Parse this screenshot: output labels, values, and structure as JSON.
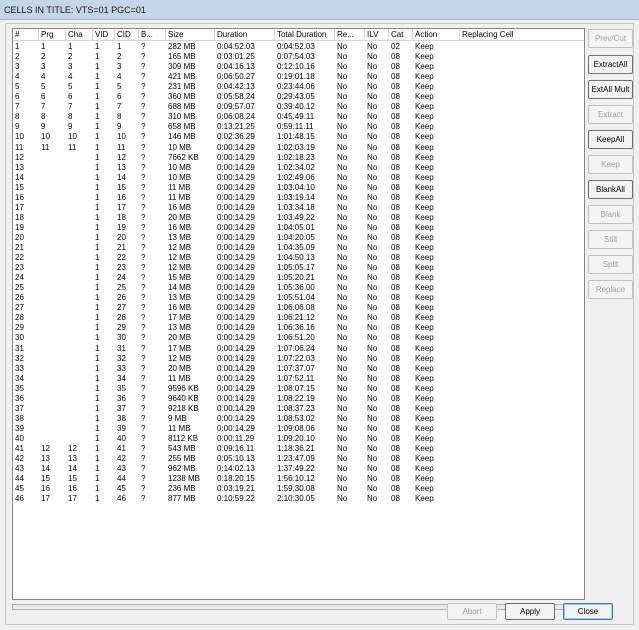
{
  "window": {
    "title": "CELLS IN TITLE: VTS=01 PGC=01"
  },
  "columns": [
    "#",
    "Prg",
    "Cha",
    "VID",
    "CID",
    "B...",
    "Size",
    "Duration",
    "Total Duration",
    "Re...",
    "ILV",
    "Cat",
    "Action",
    "Replacing Cell"
  ],
  "rows": [
    [
      "1",
      "1",
      "1",
      "1",
      "1",
      "?",
      "282 MB",
      "0:04:52.03",
      "0:04:52.03",
      "No",
      "No",
      "02",
      "Keep",
      ""
    ],
    [
      "2",
      "2",
      "2",
      "1",
      "2",
      "?",
      "165 MB",
      "0:03:01.25",
      "0:07:54.03",
      "No",
      "No",
      "08",
      "Keep",
      ""
    ],
    [
      "3",
      "3",
      "3",
      "1",
      "3",
      "?",
      "309 MB",
      "0:04:16.13",
      "0:12:10.16",
      "No",
      "No",
      "08",
      "Keep",
      ""
    ],
    [
      "4",
      "4",
      "4",
      "1",
      "4",
      "?",
      "421 MB",
      "0:06:50.27",
      "0:19:01.18",
      "No",
      "No",
      "08",
      "Keep",
      ""
    ],
    [
      "5",
      "5",
      "5",
      "1",
      "5",
      "?",
      "231 MB",
      "0:04:42.13",
      "0:23:44.06",
      "No",
      "No",
      "08",
      "Keep",
      ""
    ],
    [
      "6",
      "6",
      "6",
      "1",
      "6",
      "?",
      "360 MB",
      "0:05:58.24",
      "0:29:43.05",
      "No",
      "No",
      "08",
      "Keep",
      ""
    ],
    [
      "7",
      "7",
      "7",
      "1",
      "7",
      "?",
      "688 MB",
      "0:09:57.07",
      "0:39:40.12",
      "No",
      "No",
      "08",
      "Keep",
      ""
    ],
    [
      "8",
      "8",
      "8",
      "1",
      "8",
      "?",
      "310 MB",
      "0:06:08.24",
      "0:45:49.11",
      "No",
      "No",
      "08",
      "Keep",
      ""
    ],
    [
      "9",
      "9",
      "9",
      "1",
      "9",
      "?",
      "658 MB",
      "0:13:21.25",
      "0:59:11.11",
      "No",
      "No",
      "08",
      "Keep",
      ""
    ],
    [
      "10",
      "10",
      "10",
      "1",
      "10",
      "?",
      "146 MB",
      "0:02:36.29",
      "1:01:48.15",
      "No",
      "No",
      "08",
      "Keep",
      ""
    ],
    [
      "11",
      "11",
      "11",
      "1",
      "11",
      "?",
      "10 MB",
      "0:00:14.29",
      "1:02:03.19",
      "No",
      "No",
      "08",
      "Keep",
      ""
    ],
    [
      "12",
      "",
      "",
      "1",
      "12",
      "?",
      "7662 KB",
      "0:00:14.29",
      "1:02:18.23",
      "No",
      "No",
      "08",
      "Keep",
      ""
    ],
    [
      "13",
      "",
      "",
      "1",
      "13",
      "?",
      "10 MB",
      "0:00:14.29",
      "1:02:34.02",
      "No",
      "No",
      "08",
      "Keep",
      ""
    ],
    [
      "14",
      "",
      "",
      "1",
      "14",
      "?",
      "10 MB",
      "0:00:14.29",
      "1:02:49.06",
      "No",
      "No",
      "08",
      "Keep",
      ""
    ],
    [
      "15",
      "",
      "",
      "1",
      "15",
      "?",
      "11 MB",
      "0:00:14.29",
      "1:03:04.10",
      "No",
      "No",
      "08",
      "Keep",
      ""
    ],
    [
      "16",
      "",
      "",
      "1",
      "16",
      "?",
      "11 MB",
      "0:00:14.29",
      "1:03:19.14",
      "No",
      "No",
      "08",
      "Keep",
      ""
    ],
    [
      "17",
      "",
      "",
      "1",
      "17",
      "?",
      "16 MB",
      "0:00:14.29",
      "1:03:34.18",
      "No",
      "No",
      "08",
      "Keep",
      ""
    ],
    [
      "18",
      "",
      "",
      "1",
      "18",
      "?",
      "20 MB",
      "0:00:14.29",
      "1:03:49.22",
      "No",
      "No",
      "08",
      "Keep",
      ""
    ],
    [
      "19",
      "",
      "",
      "1",
      "19",
      "?",
      "16 MB",
      "0:00:14.29",
      "1:04:05.01",
      "No",
      "No",
      "08",
      "Keep",
      ""
    ],
    [
      "20",
      "",
      "",
      "1",
      "20",
      "?",
      "13 MB",
      "0:00:14.29",
      "1:04:20.05",
      "No",
      "No",
      "08",
      "Keep",
      ""
    ],
    [
      "21",
      "",
      "",
      "1",
      "21",
      "?",
      "12 MB",
      "0:00:14.29",
      "1:04:35.09",
      "No",
      "No",
      "08",
      "Keep",
      ""
    ],
    [
      "22",
      "",
      "",
      "1",
      "22",
      "?",
      "12 MB",
      "0:00:14.29",
      "1:04:50.13",
      "No",
      "No",
      "08",
      "Keep",
      ""
    ],
    [
      "23",
      "",
      "",
      "1",
      "23",
      "?",
      "12 MB",
      "0:00:14.29",
      "1:05:05.17",
      "No",
      "No",
      "08",
      "Keep",
      ""
    ],
    [
      "24",
      "",
      "",
      "1",
      "24",
      "?",
      "15 MB",
      "0:00:14.29",
      "1:05:20.21",
      "No",
      "No",
      "08",
      "Keep",
      ""
    ],
    [
      "25",
      "",
      "",
      "1",
      "25",
      "?",
      "14 MB",
      "0:00:14.29",
      "1:05:36.00",
      "No",
      "No",
      "08",
      "Keep",
      ""
    ],
    [
      "26",
      "",
      "",
      "1",
      "26",
      "?",
      "13 MB",
      "0:00:14.29",
      "1:05:51.04",
      "No",
      "No",
      "08",
      "Keep",
      ""
    ],
    [
      "27",
      "",
      "",
      "1",
      "27",
      "?",
      "16 MB",
      "0:00:14.29",
      "1:06:06.08",
      "No",
      "No",
      "08",
      "Keep",
      ""
    ],
    [
      "28",
      "",
      "",
      "1",
      "28",
      "?",
      "17 MB",
      "0:00:14.29",
      "1:06:21.12",
      "No",
      "No",
      "08",
      "Keep",
      ""
    ],
    [
      "29",
      "",
      "",
      "1",
      "29",
      "?",
      "13 MB",
      "0:00:14.29",
      "1:06:36.16",
      "No",
      "No",
      "08",
      "Keep",
      ""
    ],
    [
      "30",
      "",
      "",
      "1",
      "30",
      "?",
      "20 MB",
      "0:00:14.29",
      "1:06:51.20",
      "No",
      "No",
      "08",
      "Keep",
      ""
    ],
    [
      "31",
      "",
      "",
      "1",
      "31",
      "?",
      "17 MB",
      "0:00:14.29",
      "1:07:06.24",
      "No",
      "No",
      "08",
      "Keep",
      ""
    ],
    [
      "32",
      "",
      "",
      "1",
      "32",
      "?",
      "12 MB",
      "0:00:14.29",
      "1:07:22.03",
      "No",
      "No",
      "08",
      "Keep",
      ""
    ],
    [
      "33",
      "",
      "",
      "1",
      "33",
      "?",
      "20 MB",
      "0:00:14.29",
      "1:07:37.07",
      "No",
      "No",
      "08",
      "Keep",
      ""
    ],
    [
      "34",
      "",
      "",
      "1",
      "34",
      "?",
      "11 MB",
      "0:00:14.29",
      "1:07:52.11",
      "No",
      "No",
      "08",
      "Keep",
      ""
    ],
    [
      "35",
      "",
      "",
      "1",
      "35",
      "?",
      "9596 KB",
      "0:00:14.29",
      "1:08:07.15",
      "No",
      "No",
      "08",
      "Keep",
      ""
    ],
    [
      "36",
      "",
      "",
      "1",
      "36",
      "?",
      "9640 KB",
      "0:00:14.29",
      "1:08:22.19",
      "No",
      "No",
      "08",
      "Keep",
      ""
    ],
    [
      "37",
      "",
      "",
      "1",
      "37",
      "?",
      "9218 KB",
      "0:00:14.29",
      "1:08:37.23",
      "No",
      "No",
      "08",
      "Keep",
      ""
    ],
    [
      "38",
      "",
      "",
      "1",
      "38",
      "?",
      "9 MB",
      "0:00:14.29",
      "1:08:53.02",
      "No",
      "No",
      "08",
      "Keep",
      ""
    ],
    [
      "39",
      "",
      "",
      "1",
      "39",
      "?",
      "11 MB",
      "0:00:14.29",
      "1:09:08.06",
      "No",
      "No",
      "08",
      "Keep",
      ""
    ],
    [
      "40",
      "",
      "",
      "1",
      "40",
      "?",
      "8112 KB",
      "0:00:11.29",
      "1:09:20.10",
      "No",
      "No",
      "08",
      "Keep",
      ""
    ],
    [
      "41",
      "12",
      "12",
      "1",
      "41",
      "?",
      "543 MB",
      "0:09:16.11",
      "1:18:36.21",
      "No",
      "No",
      "08",
      "Keep",
      ""
    ],
    [
      "42",
      "13",
      "13",
      "1",
      "42",
      "?",
      "255 MB",
      "0:05:10.13",
      "1:23:47.09",
      "No",
      "No",
      "08",
      "Keep",
      ""
    ],
    [
      "43",
      "14",
      "14",
      "1",
      "43",
      "?",
      "962 MB",
      "0:14:02.13",
      "1:37:49.22",
      "No",
      "No",
      "08",
      "Keep",
      ""
    ],
    [
      "44",
      "15",
      "15",
      "1",
      "44",
      "?",
      "1238 MB",
      "0:18:20.15",
      "1:56:10.12",
      "No",
      "No",
      "08",
      "Keep",
      ""
    ],
    [
      "45",
      "16",
      "16",
      "1",
      "45",
      "?",
      "236 MB",
      "0:03:19.21",
      "1:59:30.08",
      "No",
      "No",
      "08",
      "Keep",
      ""
    ],
    [
      "46",
      "17",
      "17",
      "1",
      "46",
      "?",
      "877 MB",
      "0:10:59.22",
      "2:10:30.05",
      "No",
      "No",
      "08",
      "Keep",
      ""
    ]
  ],
  "side_buttons": [
    {
      "label": "Prev/Cut",
      "enabled": false
    },
    {
      "label": "ExtractAll",
      "enabled": true
    },
    {
      "label": "ExtAll Mult",
      "enabled": true
    },
    {
      "label": "Extract",
      "enabled": false
    },
    {
      "label": "KeepAll",
      "enabled": true
    },
    {
      "label": "Keep",
      "enabled": false
    },
    {
      "label": "BlankAll",
      "enabled": true
    },
    {
      "label": "Blank",
      "enabled": false
    },
    {
      "label": "Still",
      "enabled": false
    },
    {
      "label": "Split",
      "enabled": false
    },
    {
      "label": "Replace",
      "enabled": false
    }
  ],
  "bottom_buttons": {
    "abort": "Abort",
    "apply": "Apply",
    "close": "Close"
  }
}
